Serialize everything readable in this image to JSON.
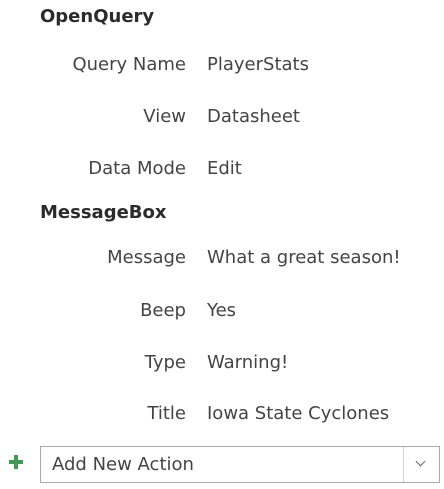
{
  "actions": [
    {
      "name": "OpenQuery",
      "arguments": [
        {
          "label": "Query Name",
          "value": "PlayerStats"
        },
        {
          "label": "View",
          "value": "Datasheet"
        },
        {
          "label": "Data Mode",
          "value": "Edit"
        }
      ]
    },
    {
      "name": "MessageBox",
      "arguments": [
        {
          "label": "Message",
          "value": "What a great season!"
        },
        {
          "label": "Beep",
          "value": "Yes"
        },
        {
          "label": "Type",
          "value": "Warning!"
        },
        {
          "label": "Title",
          "value": "Iowa State Cyclones"
        }
      ]
    }
  ],
  "add_action": {
    "label": "Add New Action",
    "icon": "plus-icon",
    "dropdown_icon": "chevron-down-icon",
    "accent_color": "#3f9a57"
  }
}
